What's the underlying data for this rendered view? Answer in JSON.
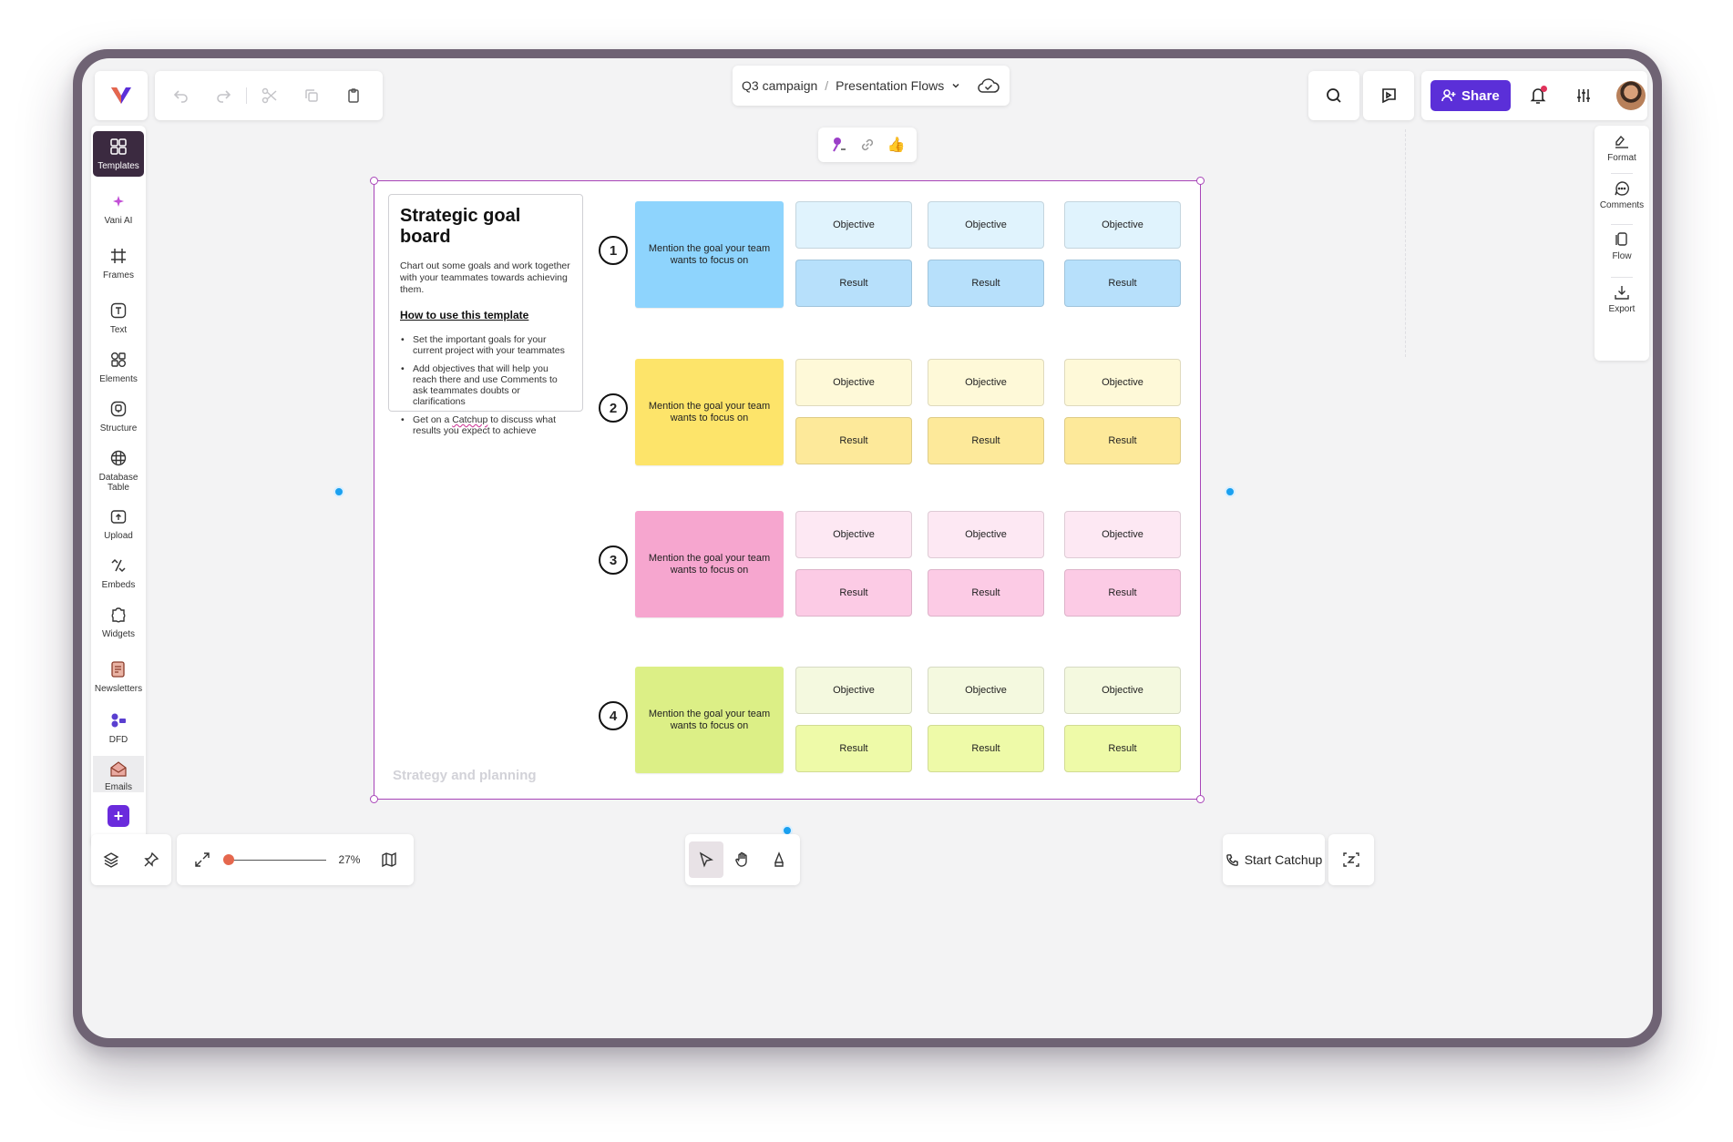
{
  "breadcrumb": {
    "project": "Q3 campaign",
    "separator": "/",
    "page": "Presentation Flows"
  },
  "topbar": {
    "share_label": "Share"
  },
  "left_tools": [
    "Templates",
    "Vani AI",
    "Frames",
    "Text",
    "Elements",
    "Structure",
    "Database Table",
    "Upload",
    "Embeds",
    "Widgets",
    "Newsletters",
    "DFD",
    "Emails"
  ],
  "right_tools": [
    "Format",
    "Comments",
    "Flow",
    "Export"
  ],
  "board": {
    "title": "Strategic goal board",
    "description": "Chart out some goals and work together with your teammates towards achieving them.",
    "howto_title": "How to use this template",
    "bullets": {
      "b1": "Set the important goals for your current project with your teammates",
      "b2": "Add objectives that will help you reach there and use Comments to ask teammates doubts or clarifications",
      "b3_pre": "Get on a ",
      "b3_link": "Catchup",
      "b3_post": " to discuss what results you expect to achieve"
    },
    "footer": "Strategy and planning",
    "goal_text": "Mention the goal your team wants to focus on",
    "objective_label": "Objective",
    "result_label": "Result",
    "rows": [
      {
        "num": "1",
        "goal_color": "#8ed4fd",
        "obj_color": "#e0f3fd",
        "res_color": "#b7e0fb"
      },
      {
        "num": "2",
        "goal_color": "#fde46a",
        "obj_color": "#fef9d8",
        "res_color": "#fde99a"
      },
      {
        "num": "3",
        "goal_color": "#f6a6cf",
        "obj_color": "#fde8f3",
        "res_color": "#fccbe5"
      },
      {
        "num": "4",
        "goal_color": "#dcef86",
        "obj_color": "#f4f9df",
        "res_color": "#eefaa8"
      }
    ]
  },
  "bottom": {
    "zoom": "27%",
    "catchup_label": "Start Catchup"
  }
}
